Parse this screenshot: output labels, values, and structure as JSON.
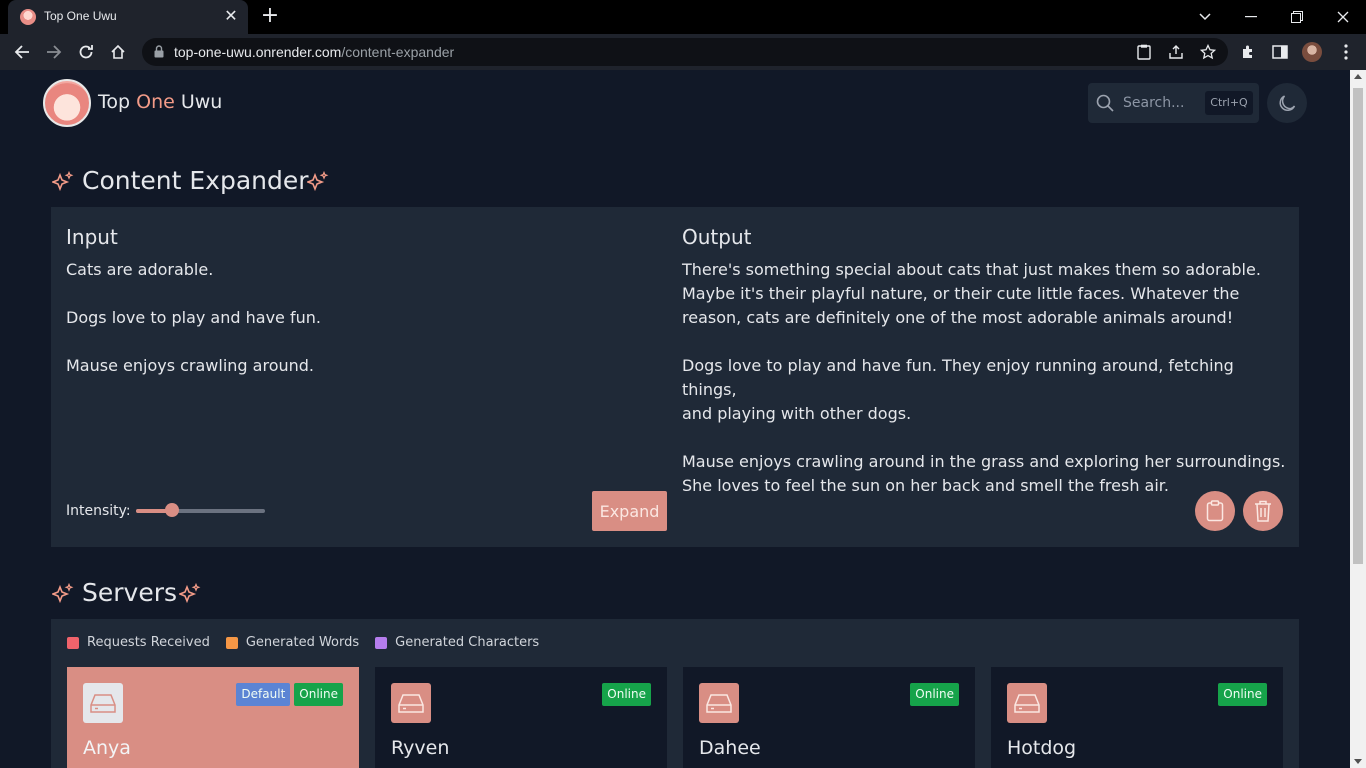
{
  "browser": {
    "tab_title": "Top One Uwu",
    "url_domain": "top-one-uwu.onrender.com",
    "url_path": "/content-expander"
  },
  "header": {
    "brand_part1": "Top ",
    "brand_accent": "One",
    "brand_part2": " Uwu",
    "search_placeholder": "Search...",
    "search_shortcut": "Ctrl+Q"
  },
  "expander": {
    "title": "Content Expander",
    "input_heading": "Input",
    "input_text": "Cats are adorable.\n\nDogs love to play and have fun.\n\nMause enjoys crawling around.",
    "output_heading": "Output",
    "output_text": "There's something special about cats that just makes them so adorable.\nMaybe it's their playful nature, or their cute little faces. Whatever the\nreason, cats are definitely one of the most adorable animals around!\n\nDogs love to play and have fun. They enjoy running around, fetching things,\nand playing with other dogs.\n\nMause enjoys crawling around in the grass and exploring her surroundings.\nShe loves to feel the sun on her back and smell the fresh air.",
    "intensity_label": "Intensity:",
    "intensity_value": 0.28,
    "expand_label": "Expand"
  },
  "servers": {
    "title": "Servers",
    "legend": [
      {
        "label": "Requests Received",
        "color": "#f0636b"
      },
      {
        "label": "Generated Words",
        "color": "#f59746"
      },
      {
        "label": "Generated Characters",
        "color": "#b57ded"
      }
    ],
    "cards": [
      {
        "name": "Anya",
        "default_badge": "Default",
        "status": "Online"
      },
      {
        "name": "Ryven",
        "status": "Online"
      },
      {
        "name": "Dahee",
        "status": "Online"
      },
      {
        "name": "Hotdog",
        "status": "Online"
      }
    ]
  },
  "colors": {
    "accent": "#d98e84",
    "page_bg": "#111827",
    "panel_bg": "#1f2937",
    "online": "#16a34a",
    "default": "#5b84d4"
  }
}
